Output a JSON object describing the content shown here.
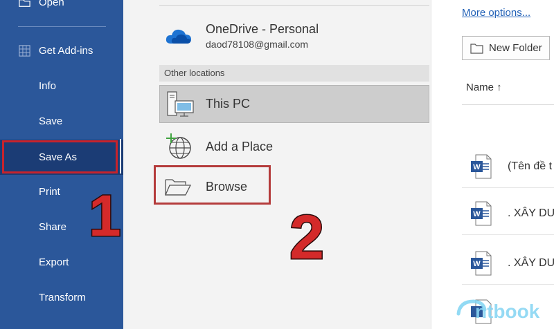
{
  "sidebar": {
    "items": [
      {
        "label": "Open"
      },
      {
        "label": "Get Add-ins"
      },
      {
        "label": "Info"
      },
      {
        "label": "Save"
      },
      {
        "label": "Save As",
        "selected": true
      },
      {
        "label": "Print"
      },
      {
        "label": "Share"
      },
      {
        "label": "Export"
      },
      {
        "label": "Transform"
      }
    ]
  },
  "annotations": {
    "step1": "1",
    "step2": "2"
  },
  "locations": {
    "onedrive": {
      "title": "OneDrive - Personal",
      "email": "daod78108@gmail.com"
    },
    "other_header": "Other locations",
    "this_pc": "This PC",
    "add_place": "Add a Place",
    "browse": "Browse"
  },
  "files_panel": {
    "more_options": "More options...",
    "new_folder": "New Folder",
    "name_header": "Name ↑",
    "files": [
      {
        "name": "(Tên đề t",
        "icon": "word-doc-icon"
      },
      {
        "name": ". XÂY DU",
        "icon": "word-doc-icon"
      },
      {
        "name": ". XÂY DU",
        "icon": "word-doc-icon"
      }
    ]
  },
  "watermark": "ntbook",
  "colors": {
    "sidebar": "#2b579a",
    "sidebar_selected": "#1b3c75",
    "highlight_box": "#c8232c",
    "link": "#1f5fb6",
    "word_blue": "#2b579a"
  }
}
